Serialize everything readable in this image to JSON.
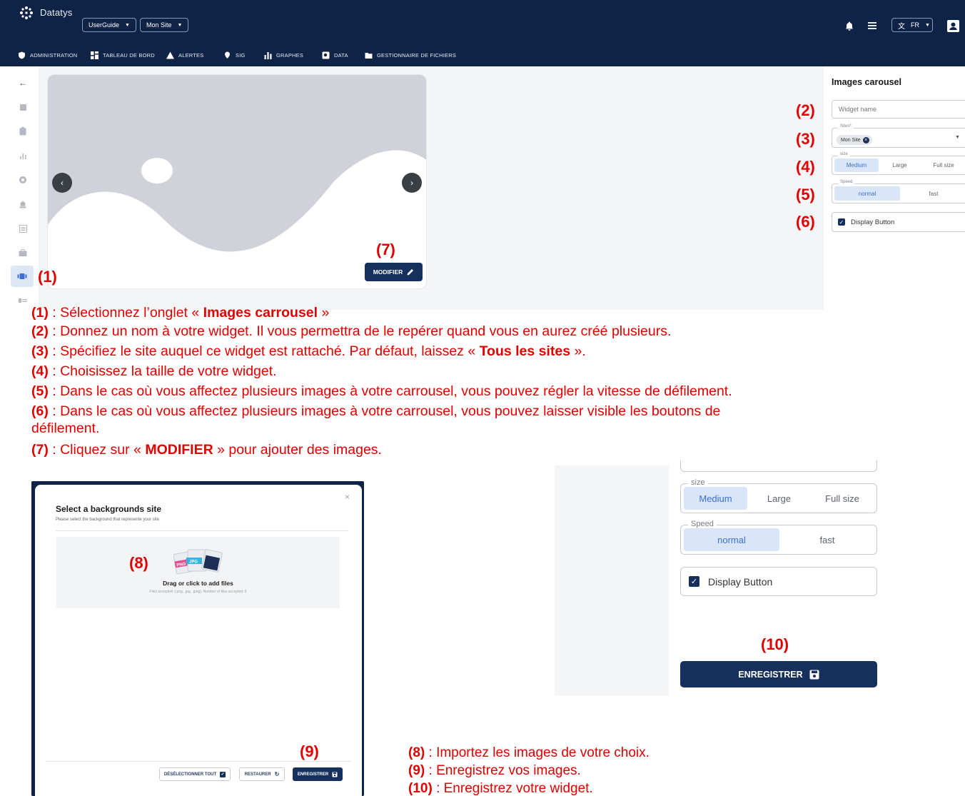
{
  "colors": {
    "navy": "#0f2347",
    "accent": "#3e6ed1",
    "selected_bg": "#d9e6fa",
    "annotation_red": "#e00000"
  },
  "topbar": {
    "brand": "Datatys",
    "guide_select": "UserGuide",
    "site_select": "Mon Site",
    "lang_select": "FR"
  },
  "nav": {
    "items": [
      {
        "label": "ADMINISTRATION",
        "icon": "shield-icon"
      },
      {
        "label": "TABLEAU DE BORD",
        "icon": "dashboard-icon"
      },
      {
        "label": "ALERTES",
        "icon": "warning-icon"
      },
      {
        "label": "SIG",
        "icon": "map-pin-icon"
      },
      {
        "label": "GRAPHES",
        "icon": "bar-chart-icon"
      },
      {
        "label": "DATA",
        "icon": "data-icon"
      },
      {
        "label": "GESTIONNAIRE DE FICHIERS",
        "icon": "folder-icon"
      }
    ]
  },
  "carousel": {
    "modifier_label": "MODIFIER"
  },
  "panel": {
    "title": "Images carousel",
    "widget_name_placeholder": "Widget name",
    "sites_legend": "Sites*",
    "site_chip": "Mon Site",
    "size_legend": "size",
    "size_options": [
      "Medium",
      "Large",
      "Full size"
    ],
    "speed_legend": "Speed",
    "speed_options": [
      "normal",
      "fast"
    ],
    "display_button_label": "Display Button"
  },
  "annotations": {
    "n1": "(1)",
    "n2": "(2)",
    "n3": "(3)",
    "n4": "(4)",
    "n5": "(5)",
    "n6": "(6)",
    "n7": "(7)",
    "n8": "(8)",
    "n9": "(9)",
    "n10": "(10)"
  },
  "instructions": {
    "l1_a": " : Sélectionnez l’onglet « ",
    "l1_b": "Images carrousel",
    "l1_c": " »",
    "l2": " : Donnez un nom à votre widget. Il vous permettra de le repérer quand vous en aurez créé plusieurs.",
    "l3_a": " : Spécifiez le site auquel ce widget est rattaché. Par défaut, laissez « ",
    "l3_b": "Tous les sites",
    "l3_c": " ».",
    "l4": " : Choisissez la taille de votre widget.",
    "l5": " : Dans le cas où vous affectez plusieurs images à votre carrousel, vous pouvez régler la vitesse de défilement.",
    "l6a": " : Dans le cas où vous affectez plusieurs images à votre carrousel, vous pouvez laisser visible les boutons de",
    "l6b": "défilement.",
    "l7_a": " : Cliquez sur « ",
    "l7_b": "MODIFIER",
    "l7_c": " » pour ajouter des images.",
    "l8": " : Importez les images de votre choix.",
    "l9": " : Enregistrez vos images.",
    "l10": " : Enregistrez votre widget."
  },
  "dialog": {
    "title": "Select a backgrounds site",
    "subtitle": "Please select the background that represente your site",
    "drop_title": "Drag or click to add files",
    "drop_sub": "Files accepted: (.png, .jpg, .jpeg), Number of files accepted: 5",
    "btn_deselect": "DÉSÉLECTIONNER TOUT",
    "btn_restore": "RESTAURER",
    "btn_save": "ENREGISTRER",
    "close": "×"
  },
  "zoom": {
    "size_legend": "size",
    "size_options": [
      "Medium",
      "Large",
      "Full size"
    ],
    "speed_legend": "Speed",
    "speed_options": [
      "normal",
      "fast"
    ],
    "display_button_label": "Display Button",
    "save_label": "ENREGISTRER"
  }
}
